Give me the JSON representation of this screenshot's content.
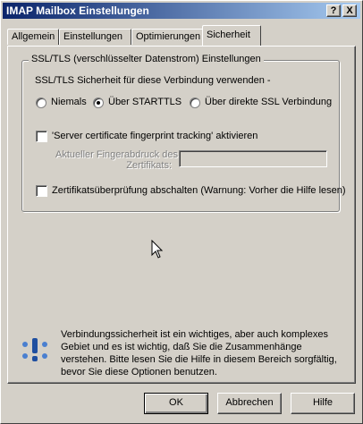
{
  "window": {
    "title": "IMAP Mailbox Einstellungen",
    "help_btn": "?",
    "close_btn": "X"
  },
  "tabs": [
    {
      "label": "Allgemein"
    },
    {
      "label": "Einstellungen"
    },
    {
      "label": "Optimierungen"
    },
    {
      "label": "Sicherheit"
    }
  ],
  "ssl_group": {
    "title": "SSL/TLS (verschlüsselter Datenstrom) Einstellungen",
    "prompt": "SSL/TLS Sicherheit für diese Verbindung verwenden -",
    "radio_options": [
      "Niemals",
      "Über STARTTLS",
      "Über direkte SSL Verbindung"
    ],
    "selected": "Über STARTTLS",
    "fingerprint_checkbox_label": "'Server certificate fingerprint tracking' aktivieren",
    "fingerprint_field_label_1": "Aktueller Fingerabdruck des",
    "fingerprint_field_label_2": "Zertifikats:",
    "fingerprint_value": "",
    "disable_check_label": "Zertifikatsüberprüfung abschalten (Warnung: Vorher die Hilfe lesen)"
  },
  "info": {
    "text": "Verbindungssicherheit ist ein wichtiges, aber auch komplexes Gebiet und es ist wichtig, daß Sie die Zusammenhänge verstehen. Bitte lesen Sie die Hilfe in diesem Bereich sorgfältig, bevor Sie diese Optionen benutzen."
  },
  "buttons": {
    "ok": "OK",
    "cancel": "Abbrechen",
    "help": "Hilfe"
  }
}
